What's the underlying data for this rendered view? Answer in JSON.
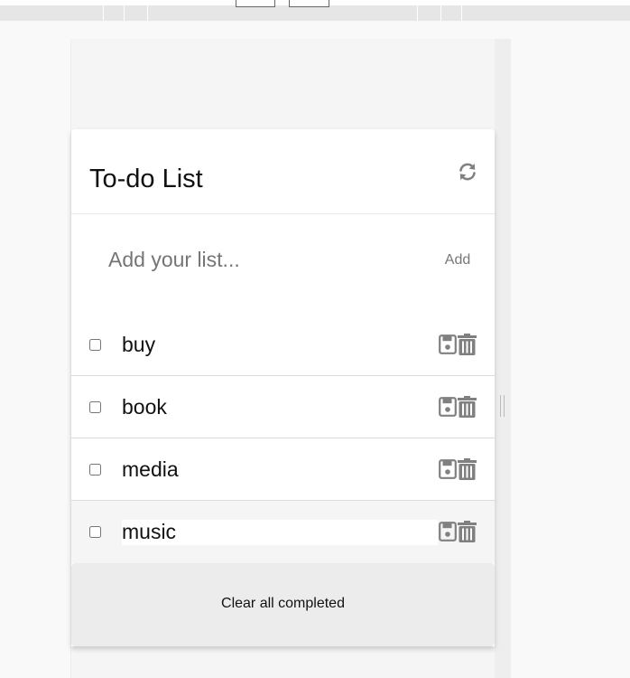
{
  "todo": {
    "title": "To-do List",
    "refresh_icon": "refresh-icon",
    "add_placeholder": "Add your list...",
    "add_label": "Add",
    "items": [
      {
        "text": "buy",
        "checked": false
      },
      {
        "text": "book",
        "checked": false
      },
      {
        "text": "media",
        "checked": false
      },
      {
        "text": "music",
        "checked": false
      }
    ],
    "item_icons": [
      "save-icon",
      "trash-icon"
    ],
    "clear_label": "Clear all completed"
  },
  "colors": {
    "icon": "#808080",
    "footer_bg": "#ececec",
    "page_bg": "#f9f9f9"
  }
}
